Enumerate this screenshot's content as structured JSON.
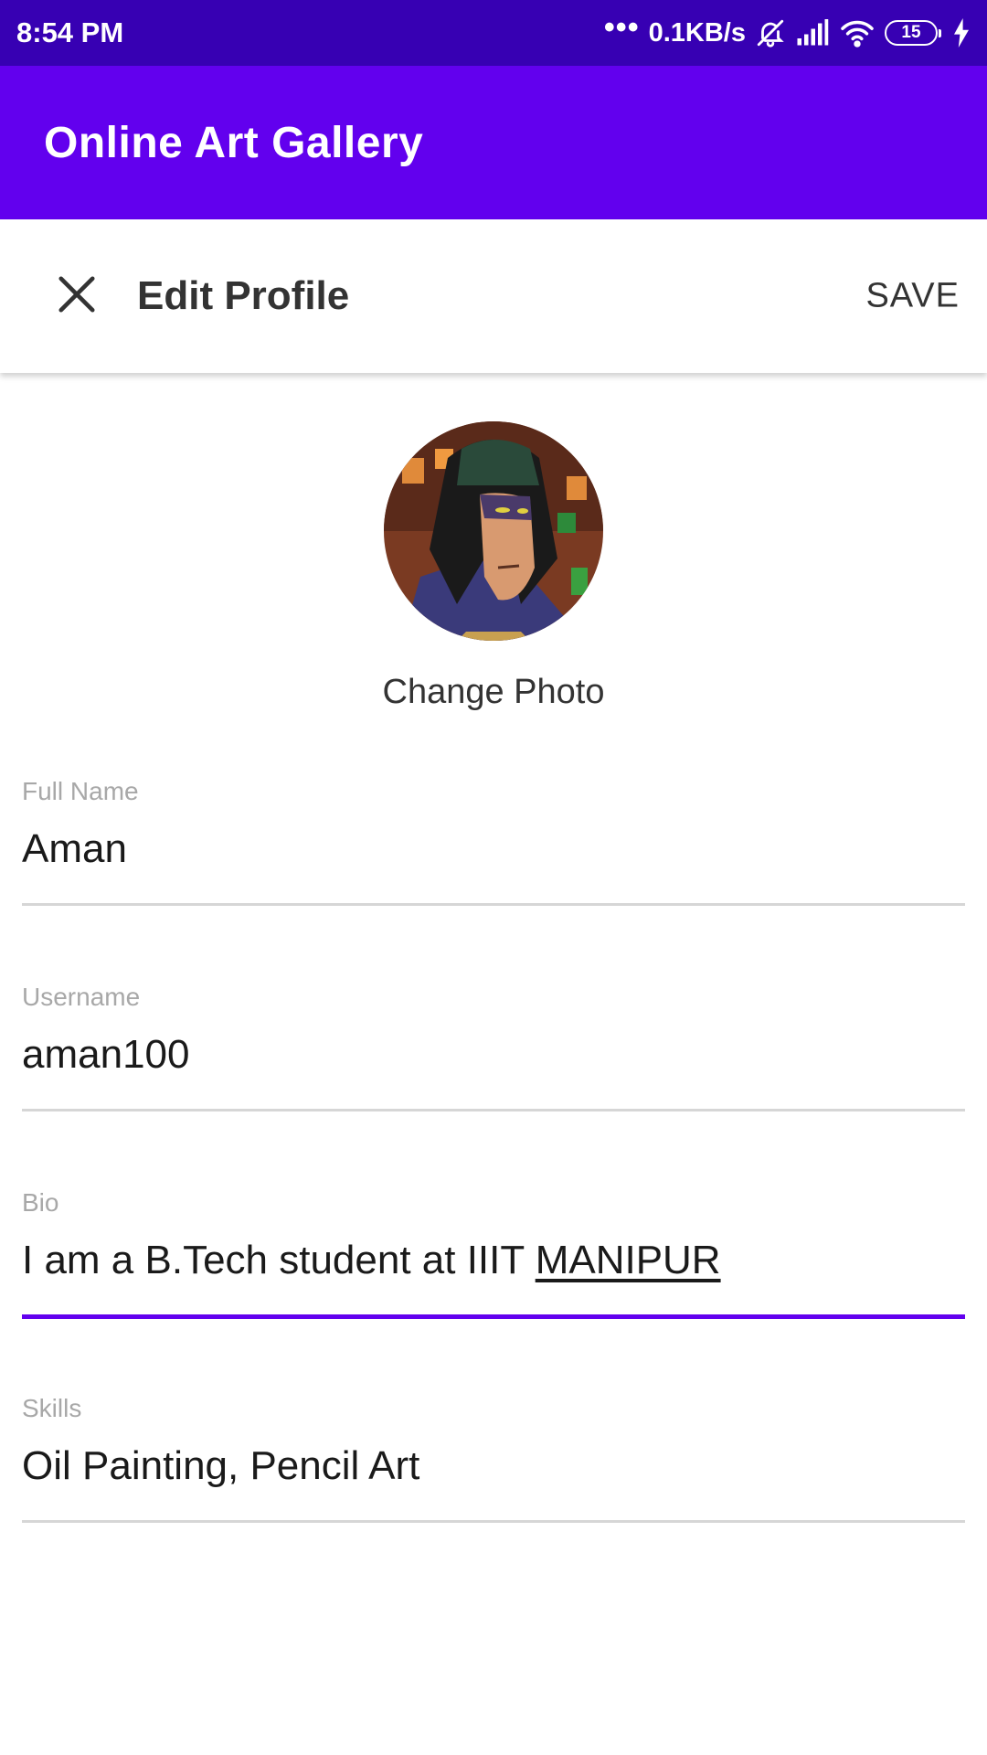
{
  "status_bar": {
    "time": "8:54 PM",
    "dots": "•••",
    "network_speed": "0.1KB/s",
    "battery": "15",
    "icons": [
      "mute-icon",
      "signal-icon",
      "wifi-icon",
      "battery-icon",
      "charging-icon"
    ]
  },
  "app_bar": {
    "title": "Online Art Gallery"
  },
  "toolbar": {
    "title": "Edit Profile",
    "save_label": "SAVE"
  },
  "profile": {
    "change_photo_label": "Change Photo"
  },
  "fields": {
    "full_name": {
      "label": "Full Name",
      "value": "Aman"
    },
    "username": {
      "label": "Username",
      "value": "aman100"
    },
    "bio": {
      "label": "Bio",
      "value_prefix": "I am a B.Tech student at IIIT ",
      "value_underlined": "MANIPUR"
    },
    "skills": {
      "label": "Skills",
      "value": "Oil Painting, Pencil Art"
    }
  },
  "colors": {
    "status_bar": "#3700b3",
    "app_bar": "#6200ee",
    "accent": "#6200ee"
  }
}
